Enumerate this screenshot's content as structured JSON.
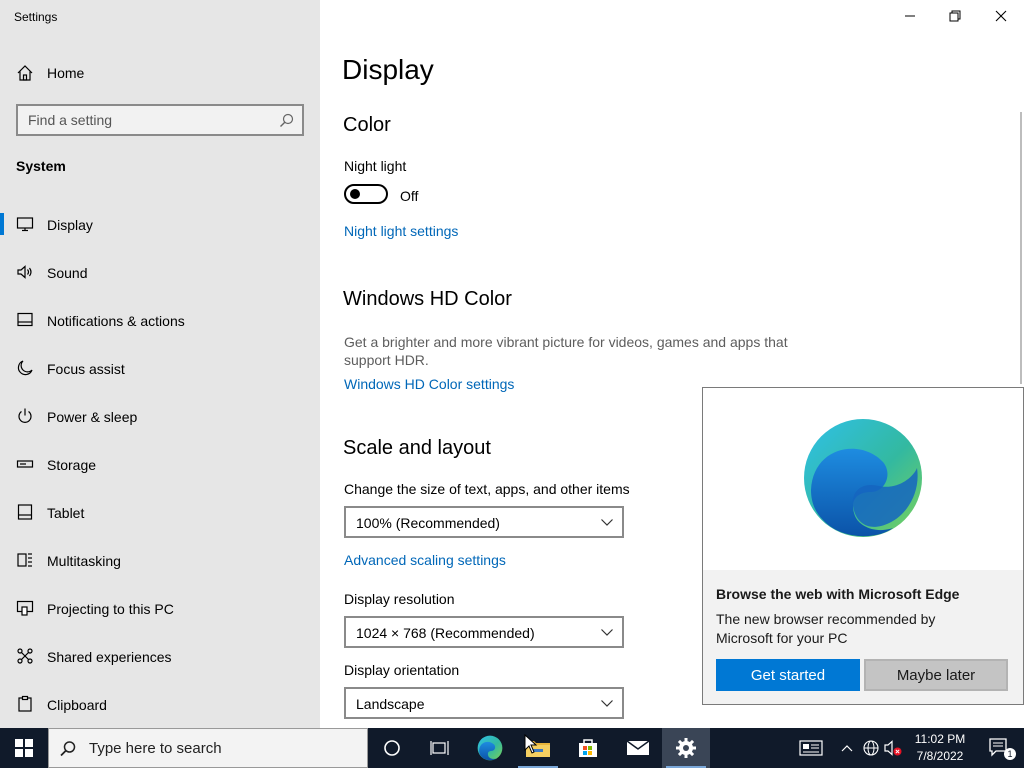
{
  "app": {
    "title": "Settings"
  },
  "sidebar": {
    "home_label": "Home",
    "search_placeholder": "Find a setting",
    "section_label": "System",
    "items": [
      {
        "label": "Display",
        "icon": "monitor-icon",
        "active": true
      },
      {
        "label": "Sound",
        "icon": "speaker-icon"
      },
      {
        "label": "Notifications & actions",
        "icon": "notification-icon"
      },
      {
        "label": "Focus assist",
        "icon": "moon-icon"
      },
      {
        "label": "Power & sleep",
        "icon": "power-icon"
      },
      {
        "label": "Storage",
        "icon": "storage-icon"
      },
      {
        "label": "Tablet",
        "icon": "tablet-icon"
      },
      {
        "label": "Multitasking",
        "icon": "multitasking-icon"
      },
      {
        "label": "Projecting to this PC",
        "icon": "projecting-icon"
      },
      {
        "label": "Shared experiences",
        "icon": "shared-icon"
      },
      {
        "label": "Clipboard",
        "icon": "clipboard-icon"
      }
    ]
  },
  "main": {
    "title": "Display",
    "color": {
      "heading": "Color",
      "night_light_label": "Night light",
      "night_light_state": "Off",
      "night_light_link": "Night light settings"
    },
    "hd_color": {
      "heading": "Windows HD Color",
      "description": "Get a brighter and more vibrant picture for videos, games and apps that support HDR.",
      "link": "Windows HD Color settings"
    },
    "scale": {
      "heading": "Scale and layout",
      "size_label": "Change the size of text, apps, and other items",
      "size_value": "100% (Recommended)",
      "advanced_link": "Advanced scaling settings",
      "resolution_label": "Display resolution",
      "resolution_value": "1024 × 768 (Recommended)",
      "orientation_label": "Display orientation",
      "orientation_value": "Landscape"
    }
  },
  "edge_popup": {
    "title": "Browse the web with Microsoft Edge",
    "body": "The new browser recommended by Microsoft for your PC",
    "primary_button": "Get started",
    "secondary_button": "Maybe later"
  },
  "taskbar": {
    "search_placeholder": "Type here to search",
    "time": "11:02 PM",
    "date": "7/8/2022",
    "notification_count": "1",
    "accent": "#0078d4"
  }
}
